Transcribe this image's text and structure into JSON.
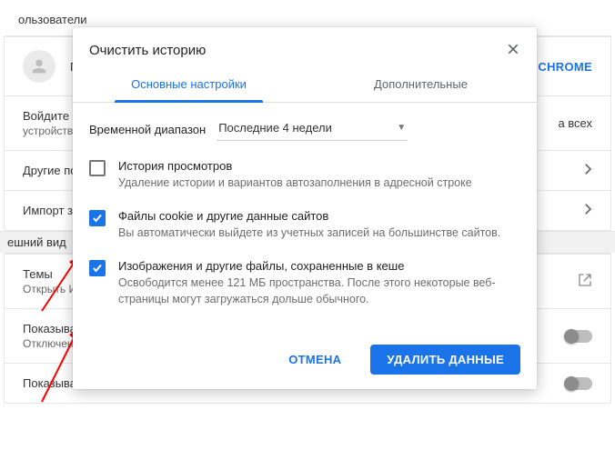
{
  "bg": {
    "users_header": "ользователи",
    "profile_letter": "П",
    "chrome_button": "В CHROME",
    "signin_line1": "Войдите в",
    "signin_line2": "устройства",
    "signin_right": "а всех",
    "other_profiles": "Другие по",
    "import_bookmarks": "Импорт за",
    "appearance_header": "ешний вид",
    "themes": "Темы",
    "themes_sub": "Открыть И",
    "show_bookmarks": "Показыват",
    "show_bookmarks_sub": "Отключено",
    "show_home": "Показыват"
  },
  "modal": {
    "title": "Очистить историю",
    "tabs": {
      "basic": "Основные настройки",
      "advanced": "Дополнительные"
    },
    "range_label": "Временной диапазон",
    "range_value": "Последние 4 недели",
    "options": [
      {
        "checked": false,
        "title": "История просмотров",
        "desc": "Удаление истории и вариантов автозаполнения в адресной строке"
      },
      {
        "checked": true,
        "title": "Файлы cookie и другие данные сайтов",
        "desc": "Вы автоматически выйдете из учетных записей на большинстве сайтов."
      },
      {
        "checked": true,
        "title": "Изображения и другие файлы, сохраненные в кеше",
        "desc": "Освободится менее 121 МБ пространства. После этого некоторые веб-страницы могут загружаться дольше обычного."
      }
    ],
    "cancel": "ОТМЕНА",
    "clear": "УДАЛИТЬ ДАННЫЕ"
  }
}
